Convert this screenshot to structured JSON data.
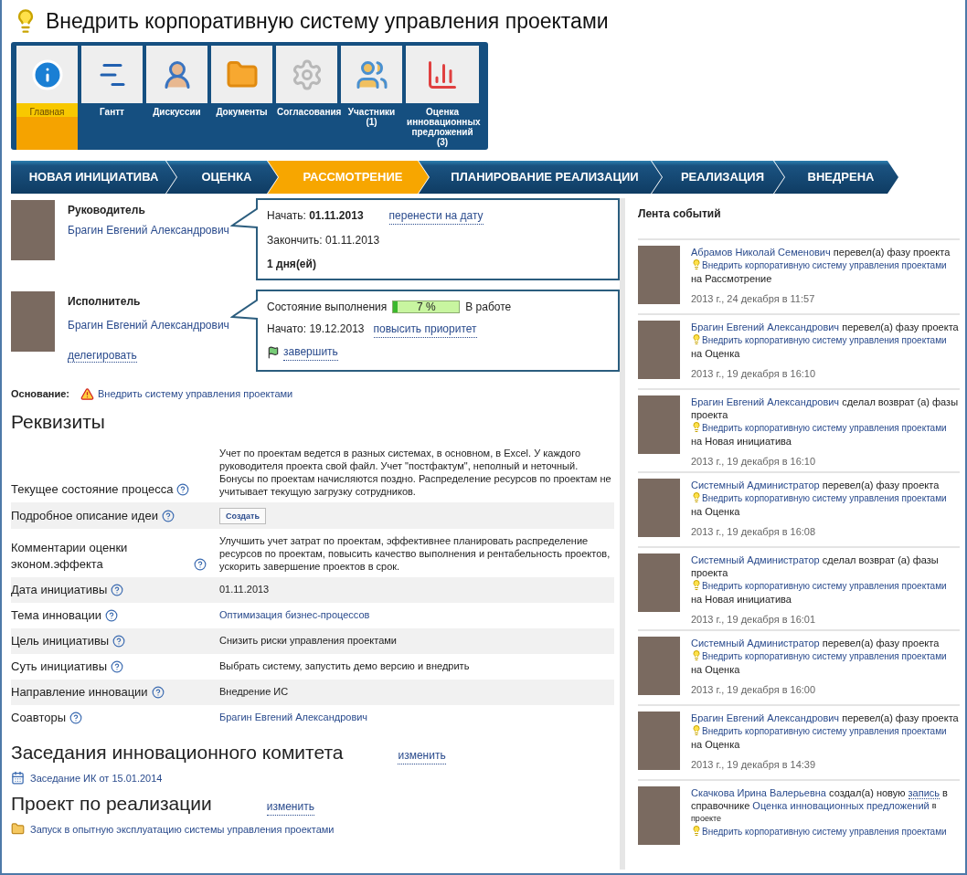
{
  "title": "Внедрить корпоративную систему управления проектами",
  "modules": [
    {
      "label": "Главная",
      "selected": true
    },
    {
      "label": "Гантт",
      "selected": false
    },
    {
      "label": "Дискуссии",
      "selected": false
    },
    {
      "label": "Документы",
      "selected": false
    },
    {
      "label": "Согласования",
      "selected": false
    },
    {
      "label": "Участники (1)",
      "selected": false
    },
    {
      "label": "Оценка инновационных предложений (3)",
      "selected": false
    }
  ],
  "phases": [
    {
      "label": "НОВАЯ ИНИЦИАТИВА",
      "selected": false
    },
    {
      "label": "ОЦЕНКА",
      "selected": false
    },
    {
      "label": "РАССМОТРЕНИЕ",
      "selected": true
    },
    {
      "label": "ПЛАНИРОВАНИЕ РЕАЛИЗАЦИИ",
      "selected": false
    },
    {
      "label": "РЕАЛИЗАЦИЯ",
      "selected": false
    },
    {
      "label": "ВНЕДРЕНА",
      "selected": false
    }
  ],
  "manager": {
    "role": "Руководитель",
    "name": "Брагин Евгений Александрович",
    "start_label": "Начать:",
    "start": "01.11.2013",
    "reschedule": "перенести на дату",
    "end": "Закончить: 01.11.2013",
    "duration": "1 дня(ей)"
  },
  "executor": {
    "role": "Исполнитель",
    "name": "Брагин Евгений Александрович",
    "delegate": "делегировать",
    "progress_label": "Состояние выполнения",
    "level": 0.07,
    "reading": "7 %",
    "status": "В работе",
    "started": "Начато: 19.12.2013",
    "raise": "повысить приоритет",
    "finish": "завершить"
  },
  "basis": {
    "label": "Основание:",
    "link": "Внедрить систему управления проектами"
  },
  "requisites": {
    "title": "Реквизиты",
    "rows": [
      {
        "label": "Текущее состояние процесса",
        "kind": "text",
        "value": "Учет по проектам ведется в разных системах, в основном, в Excel. У каждого руководителя проекта свой файл. Учет \"постфактум\", неполный и неточный. Бонусы по проектам начисляются поздно. Распределение ресурсов по проектам не учитывает текущую загрузку сотрудников."
      },
      {
        "label": "Подробное описание идеи",
        "kind": "button",
        "value": "Создать"
      },
      {
        "label": "Комментарии оценки эконом.эффекта",
        "kind": "text",
        "value": "Улучшить учет затрат по проектам, эффективнее планировать распределение ресурсов по проектам, повысить качество выполнения и рентабельность проектов, ускорить завершение проектов в срок."
      },
      {
        "label": "Дата инициативы",
        "kind": "text",
        "value": "01.11.2013"
      },
      {
        "label": "Тема инновации",
        "kind": "link",
        "value": "Оптимизация бизнес-процессов"
      },
      {
        "label": "Цель инициативы",
        "kind": "text",
        "value": "Снизить риски управления проектами"
      },
      {
        "label": "Суть инициативы",
        "kind": "text",
        "value": "Выбрать систему, запустить демо версию и внедрить"
      },
      {
        "label": "Направление инновации",
        "kind": "text",
        "value": "Внедрение ИС"
      },
      {
        "label": "Соавторы",
        "kind": "link",
        "value": "Брагин Евгений Александрович"
      }
    ]
  },
  "sections": [
    {
      "title": "Заседания инновационного комитета",
      "action": "изменить",
      "item": "Заседание ИК от 15.01.2014",
      "kind": "calendar"
    },
    {
      "title": "Проект по реализации",
      "action": "изменить",
      "item": "Запуск в опытную эксплуатацию системы управления проектами",
      "kind": "folder"
    }
  ],
  "feed": {
    "title": "Лента событий",
    "events": [
      {
        "parts": [
          {
            "kind": "link",
            "text": "Абрамов Николай Семенович"
          },
          {
            "kind": "text",
            "text": "перевел(а) фазу проекта"
          },
          {
            "kind": "project",
            "text": "Внедрить корпоративную систему управления проектами"
          },
          {
            "kind": "text",
            "text": "на Рассмотрение"
          }
        ],
        "time": "2013 г., 24 декабря в 11:57"
      },
      {
        "parts": [
          {
            "kind": "link",
            "text": "Брагин Евгений Александрович"
          },
          {
            "kind": "text",
            "text": "перевел(а) фазу проекта"
          },
          {
            "kind": "project",
            "text": "Внедрить корпоративную систему управления проектами"
          },
          {
            "kind": "text",
            "text": "на Оценка"
          }
        ],
        "time": "2013 г., 19 декабря в 16:10"
      },
      {
        "parts": [
          {
            "kind": "link",
            "text": "Брагин Евгений Александрович"
          },
          {
            "kind": "text",
            "text": "сделал возврат (а) фазы проекта"
          },
          {
            "kind": "project",
            "text": "Внедрить корпоративную систему управления проектами"
          },
          {
            "kind": "text",
            "text": "на Новая инициатива"
          }
        ],
        "time": "2013 г., 19 декабря в 16:10"
      },
      {
        "parts": [
          {
            "kind": "link",
            "text": "Системный Администратор"
          },
          {
            "kind": "text",
            "text": "перевел(а) фазу проекта"
          },
          {
            "kind": "project",
            "text": "Внедрить корпоративную систему управления проектами"
          },
          {
            "kind": "text",
            "text": "на Оценка"
          }
        ],
        "time": "2013 г., 19 декабря в 16:08"
      },
      {
        "parts": [
          {
            "kind": "link",
            "text": "Системный Администратор"
          },
          {
            "kind": "text",
            "text": "сделал возврат (а) фазы проекта"
          },
          {
            "kind": "project",
            "text": "Внедрить корпоративную систему управления проектами"
          },
          {
            "kind": "text",
            "text": "на Новая инициатива"
          }
        ],
        "time": "2013 г., 19 декабря в 16:01"
      },
      {
        "parts": [
          {
            "kind": "link",
            "text": "Системный Администратор"
          },
          {
            "kind": "text",
            "text": "перевел(а) фазу проекта"
          },
          {
            "kind": "project",
            "text": "Внедрить корпоративную систему управления проектами"
          },
          {
            "kind": "text",
            "text": "на Оценка"
          }
        ],
        "time": "2013 г., 19 декабря в 16:00"
      },
      {
        "parts": [
          {
            "kind": "link",
            "text": "Брагин Евгений Александрович"
          },
          {
            "kind": "text",
            "text": "перевел(а) фазу проекта"
          },
          {
            "kind": "project",
            "text": "Внедрить корпоративную систему управления проектами"
          },
          {
            "kind": "text",
            "text": "на Оценка"
          }
        ],
        "time": "2013 г., 19 декабря в 14:39"
      },
      {
        "parts": [
          {
            "kind": "link",
            "text": "Скачкова Ирина Валерьевна"
          },
          {
            "kind": "text",
            "text": "создал(а) новую"
          },
          {
            "kind": "dotted",
            "text": "запись"
          },
          {
            "kind": "text",
            "text": "в справочнике"
          },
          {
            "kind": "link",
            "text": "Оценка инновационных предложений"
          },
          {
            "kind": "small",
            "text": "в проекте"
          },
          {
            "kind": "project",
            "text": "Внедрить корпоративную систему управления проектами"
          }
        ]
      }
    ]
  }
}
